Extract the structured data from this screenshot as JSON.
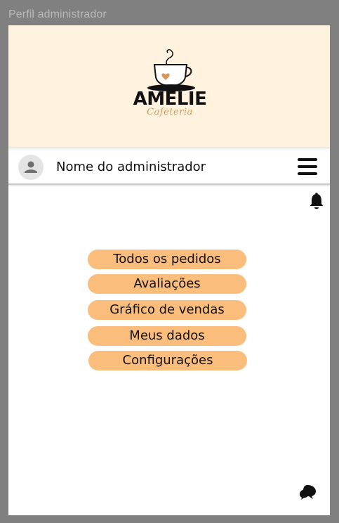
{
  "window": {
    "title": "Perfil administrador"
  },
  "logo": {
    "brand": "AMELIE",
    "subtitle": "Cafeteria"
  },
  "user": {
    "name": "Nome do administrador"
  },
  "menu": {
    "buttons": [
      {
        "label": "Todos os pedidos"
      },
      {
        "label": "Avaliações"
      },
      {
        "label": "Gráfico de vendas"
      },
      {
        "label": "Meus dados"
      },
      {
        "label": "Configurações"
      }
    ]
  },
  "icons": {
    "avatar": "person-icon",
    "menu": "hamburger-menu-icon",
    "notifications": "bell-icon",
    "chat": "chat-bubbles-icon"
  },
  "colors": {
    "background": "#808080",
    "banner": "#fff3df",
    "button": "#fbbd7b",
    "accent": "#d9965a"
  }
}
